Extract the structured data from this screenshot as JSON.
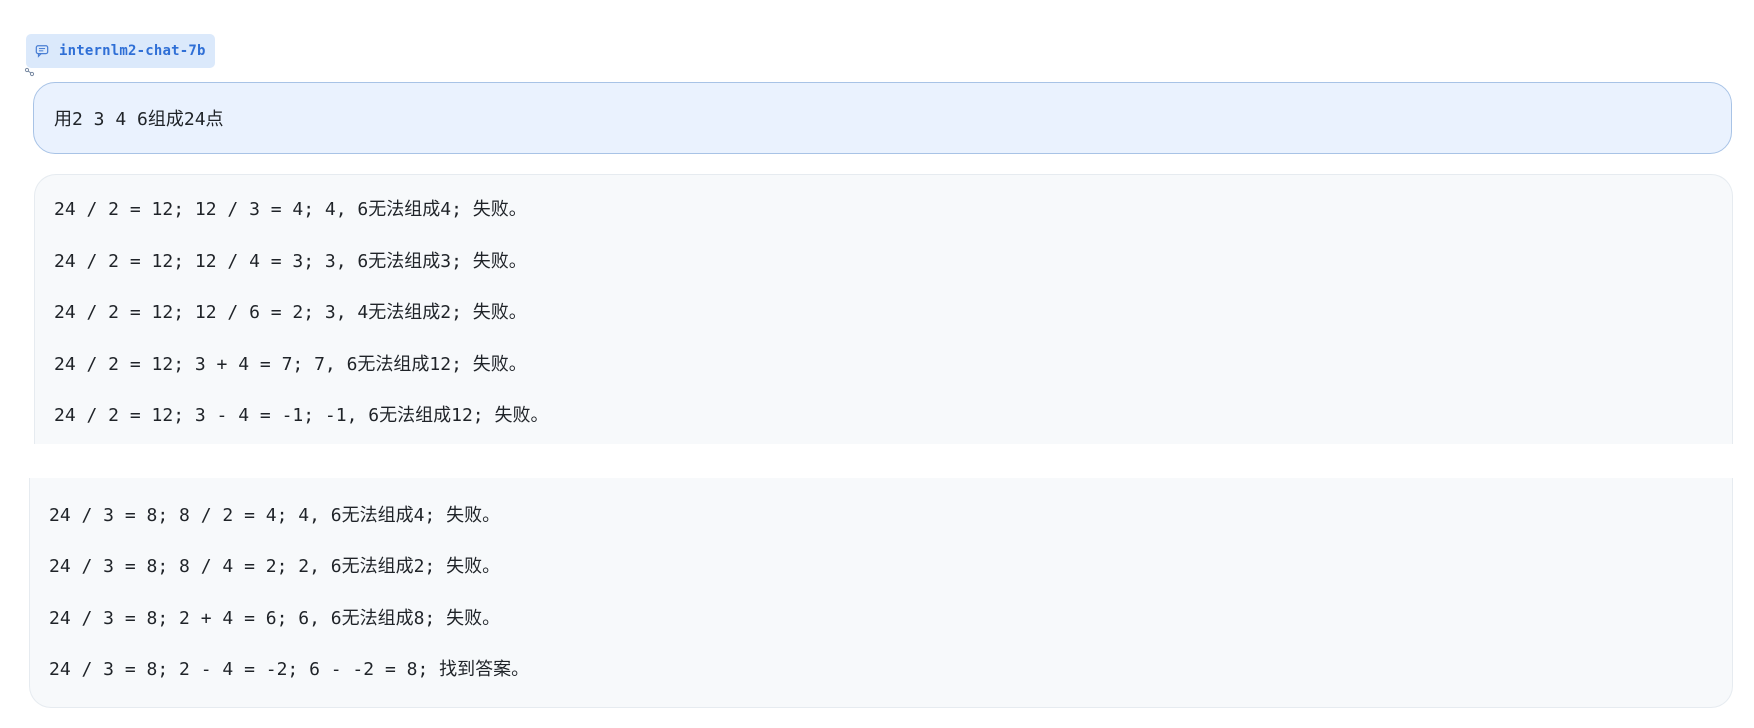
{
  "model": {
    "name": "internlm2-chat-7b",
    "icon": "chat-icon"
  },
  "user_message": "用2 3 4 6组成24点",
  "assistant": {
    "block1": [
      "24 / 2 = 12; 12 / 3 = 4; 4, 6无法组成4; 失败。",
      "24 / 2 = 12; 12 / 4 = 3; 3, 6无法组成3; 失败。",
      "24 / 2 = 12; 12 / 6 = 2; 3, 4无法组成2; 失败。",
      "24 / 2 = 12; 3 + 4 = 7; 7, 6无法组成12; 失败。",
      "24 / 2 = 12; 3 - 4 = -1; -1, 6无法组成12; 失败。"
    ],
    "block2": [
      "24 / 3 = 8; 8 / 2 = 4; 4, 6无法组成4; 失败。",
      "24 / 3 = 8; 8 / 4 = 2; 2, 6无法组成2; 失败。",
      "24 / 3 = 8; 2 + 4 = 6; 6, 6无法组成8; 失败。",
      "24 / 3 = 8; 2 - 4 = -2; 6 - -2 = 8; 找到答案。"
    ]
  },
  "colors": {
    "badge_bg": "#dbe9fb",
    "badge_text": "#2f6fd6",
    "user_bubble_bg": "#eaf2fe",
    "user_bubble_border": "#a8c3e6",
    "assistant_bg": "#f7f9fb"
  }
}
